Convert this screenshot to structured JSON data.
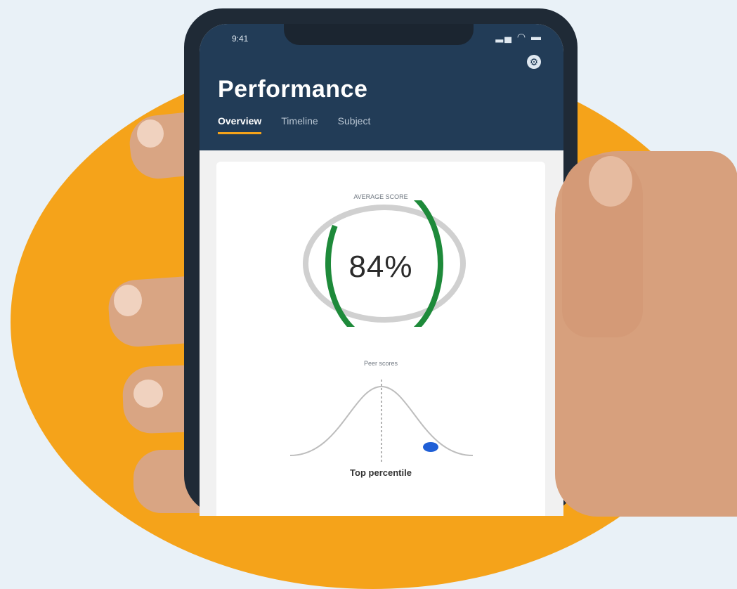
{
  "app": {
    "title": "Performance",
    "status_time": "9:41",
    "status_icons": "▂▄ ◠ ▬",
    "settings_icon": "gear-icon"
  },
  "tabs": [
    {
      "label": "Overview",
      "active": true
    },
    {
      "label": "Timeline",
      "active": false
    },
    {
      "label": "Subject",
      "active": false
    }
  ],
  "score_card": {
    "caption": "AVERAGE SCORE",
    "percent_label": "84%",
    "progress": 0.84,
    "progress_color": "#1e8a3a",
    "track_color": "#d0d0d0"
  },
  "distribution": {
    "caption": "Peer scores",
    "marker_label": "Top percentile",
    "marker_color": "#1f5fd6"
  },
  "colors": {
    "header": "#223c57",
    "accent": "#f5a31a"
  }
}
